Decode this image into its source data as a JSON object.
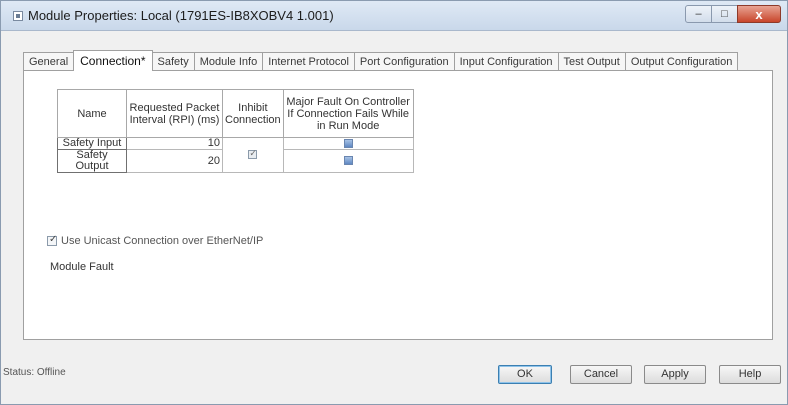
{
  "window": {
    "title": "Module Properties: Local (1791ES-IB8XOBV4 1.001)",
    "caption_buttons": {
      "minimize": "–",
      "maximize": "□",
      "close": "x"
    }
  },
  "tabs": [
    {
      "label": "General"
    },
    {
      "label": "Connection*",
      "active": true
    },
    {
      "label": "Safety"
    },
    {
      "label": "Module Info"
    },
    {
      "label": "Internet Protocol"
    },
    {
      "label": "Port Configuration"
    },
    {
      "label": "Input Configuration"
    },
    {
      "label": "Test Output"
    },
    {
      "label": "Output Configuration"
    }
  ],
  "connection_table": {
    "headers": {
      "name": "Name",
      "rpi": "Requested Packet Interval (RPI) (ms)",
      "inhibit": "Inhibit Connection",
      "major_fault": "Major Fault On Controller If Connection Fails While in Run Mode"
    },
    "rows": [
      {
        "name": "Safety Input",
        "rpi": "10",
        "major_fault_checked": true
      },
      {
        "name": "Safety Output",
        "rpi": "20",
        "major_fault_checked": true
      }
    ],
    "inhibit_checked": true
  },
  "unicast": {
    "label": "Use Unicast Connection over EtherNet/IP",
    "checked": true
  },
  "module_fault_label": "Module Fault",
  "status": {
    "text": "Status: Offline"
  },
  "buttons": {
    "ok": "OK",
    "cancel": "Cancel",
    "apply": "Apply",
    "help": "Help"
  }
}
